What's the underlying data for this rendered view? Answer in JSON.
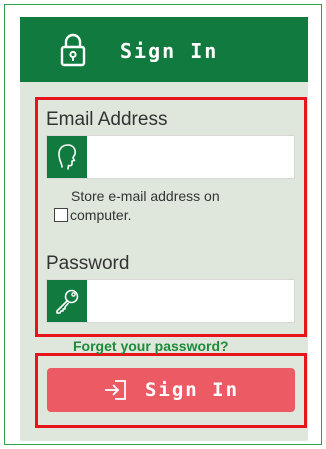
{
  "header": {
    "title": "Sign In",
    "icon": "lock-icon",
    "background": "#117a3f"
  },
  "form": {
    "email": {
      "label": "Email Address",
      "value": "",
      "placeholder": "",
      "icon": "user-head-icon"
    },
    "store_email": {
      "text_line1": "Store e-mail address on",
      "text_line2": "computer.",
      "checked": false
    },
    "password": {
      "label": "Password",
      "value": "",
      "placeholder": "",
      "icon": "key-icon"
    },
    "forgot_link": "Forget your password?",
    "submit": {
      "label": "Sign In",
      "icon": "login-arrow-icon",
      "color": "#ec5a64"
    }
  },
  "colors": {
    "highlight": "#e8141b",
    "card_bg": "#dfe7dc",
    "frame": "#2ea24a",
    "link": "#1e8a3a"
  }
}
